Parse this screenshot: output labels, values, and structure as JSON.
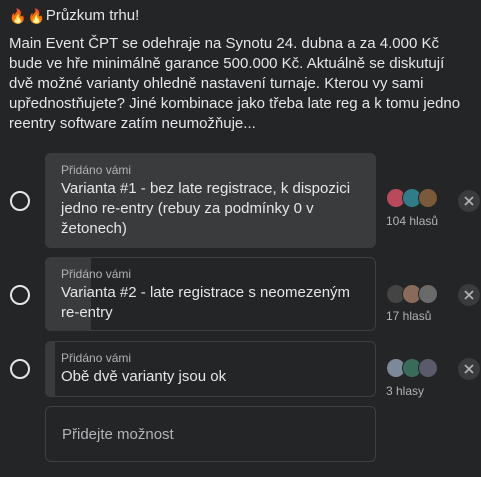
{
  "post": {
    "title": "Průzkum trhu!",
    "title_icons": [
      "fire-emoji",
      "fire-emoji"
    ],
    "body": "Main Event ČPT se odehraje na Synotu 24. dubna a za 4.000 Kč bude ve hře minimálně garance 500.000 Kč. Aktuálně se diskutují dvě možné varianty ohledně nastavení turnaje. Kterou vy sami upřednostňujete? Jiné kombinace jako třeba late reg a k tomu jedno reentry software zatím neumožňuje..."
  },
  "poll": {
    "options": [
      {
        "added_by": "Přidáno vámi",
        "label": "Varianta #1 - bez late registrace, k dispozici jedno re-entry (rebuy za podmínky 0 v žetonech)",
        "votes": "104 hlasů",
        "share": 0.84
      },
      {
        "added_by": "Přidáno vámi",
        "label": "Varianta #2 - late registrace s neomezeným re-entry",
        "votes": "17 hlasů",
        "share": 0.14
      },
      {
        "added_by": "Přidáno vámi",
        "label": "Obě dvě varianty jsou ok",
        "votes": "3 hlasy",
        "share": 0.02
      }
    ],
    "add_option_placeholder": "Přidejte možnost"
  },
  "colors": {
    "background": "#242526",
    "option_fill": "#3a3b3c",
    "text_primary": "#e4e6eb",
    "text_secondary": "#b0b3b8"
  }
}
